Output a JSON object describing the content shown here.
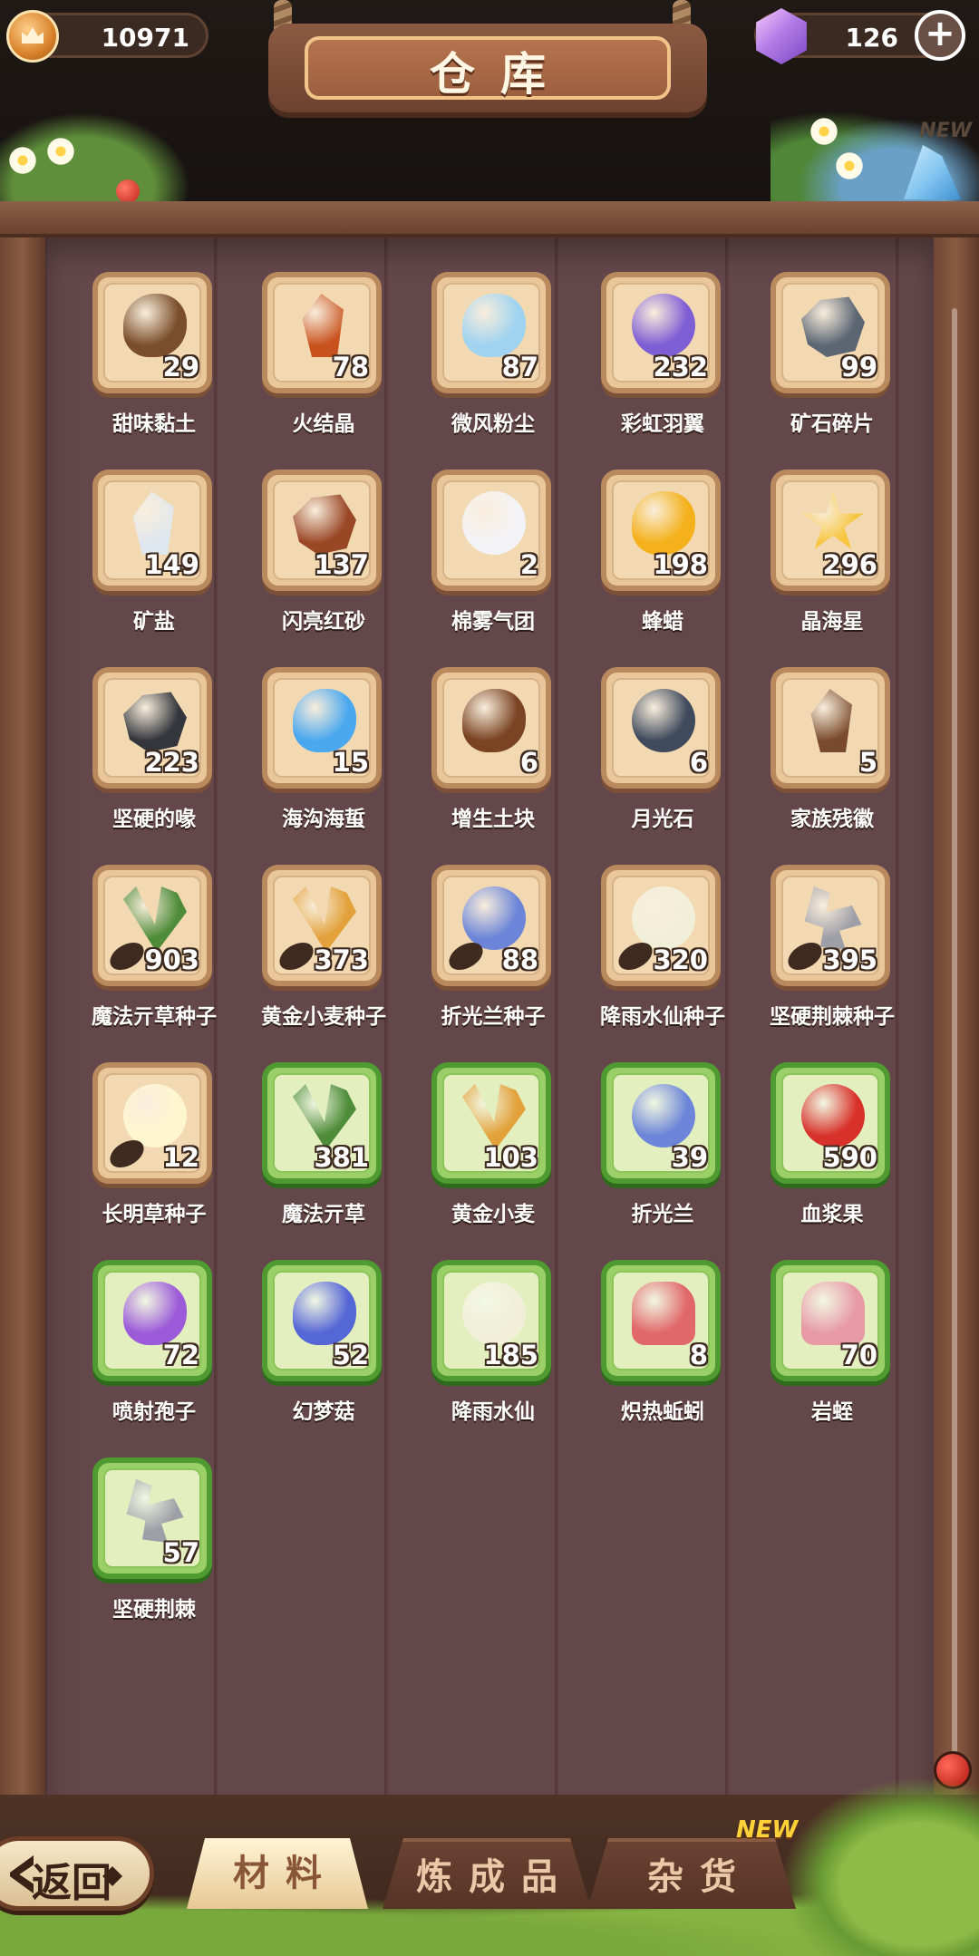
{
  "header": {
    "title": "仓库",
    "coins": "10971",
    "gems": "126"
  },
  "tabs": {
    "materials": "材料",
    "products": "炼成品",
    "goods": "杂货",
    "goods_badge": "NEW"
  },
  "back_label": "返回",
  "ghost_badge": "NEW",
  "items": [
    {
      "name": "甜味黏土",
      "qty": "29",
      "frame": "material",
      "icon": "clay-icon",
      "color": "#7a4e2a",
      "shape": "s-blob"
    },
    {
      "name": "火结晶",
      "qty": "78",
      "frame": "material",
      "icon": "fire-crystal-icon",
      "color": "#c8521e",
      "shape": "s-crystal"
    },
    {
      "name": "微风粉尘",
      "qty": "87",
      "frame": "material",
      "icon": "breeze-dust-icon",
      "color": "#9fd3f0",
      "shape": "s-blob"
    },
    {
      "name": "彩虹羽翼",
      "qty": "232",
      "frame": "material",
      "icon": "rainbow-feather-icon",
      "color": "#7e5ed4",
      "shape": "s-moon"
    },
    {
      "name": "矿石碎片",
      "qty": "99",
      "frame": "material",
      "icon": "ore-fragment-icon",
      "color": "#5c6673",
      "shape": "s-rock"
    },
    {
      "name": "矿盐",
      "qty": "149",
      "frame": "material",
      "icon": "rock-salt-icon",
      "color": "#dfe7ee",
      "shape": "s-crystal"
    },
    {
      "name": "闪亮红砂",
      "qty": "137",
      "frame": "material",
      "icon": "red-sand-icon",
      "color": "#9a4726",
      "shape": "s-rock"
    },
    {
      "name": "棉雾气团",
      "qty": "2",
      "frame": "material",
      "icon": "cotton-mist-icon",
      "color": "#f3f3f6",
      "shape": "s-circle"
    },
    {
      "name": "蜂蜡",
      "qty": "198",
      "frame": "material",
      "icon": "beeswax-icon",
      "color": "#f4b11b",
      "shape": "s-blob"
    },
    {
      "name": "晶海星",
      "qty": "296",
      "frame": "material",
      "icon": "crystal-starfish-icon",
      "color": "#f6c640",
      "shape": "s-star"
    },
    {
      "name": "坚硬的喙",
      "qty": "223",
      "frame": "material",
      "icon": "hard-beak-icon",
      "color": "#33363c",
      "shape": "s-rock"
    },
    {
      "name": "海沟海蜇",
      "qty": "15",
      "frame": "material",
      "icon": "jellyfish-icon",
      "color": "#4aa8ef",
      "shape": "s-blob"
    },
    {
      "name": "增生土块",
      "qty": "6",
      "frame": "material",
      "icon": "soil-lump-icon",
      "color": "#7a4322",
      "shape": "s-blob"
    },
    {
      "name": "月光石",
      "qty": "6",
      "frame": "material",
      "icon": "moonstone-icon",
      "color": "#3f4a5c",
      "shape": "s-moon"
    },
    {
      "name": "家族残徽",
      "qty": "5",
      "frame": "material",
      "icon": "family-crest-icon",
      "color": "#7a4a2c",
      "shape": "s-crystal"
    },
    {
      "name": "魔法亓草种子",
      "qty": "903",
      "frame": "material",
      "icon": "magic-herb-seed-icon",
      "color": "#4f8c3a",
      "shape": "s-leaf",
      "seed": true
    },
    {
      "name": "黄金小麦种子",
      "qty": "373",
      "frame": "material",
      "icon": "golden-wheat-seed-icon",
      "color": "#e2a13a",
      "shape": "s-leaf",
      "seed": true
    },
    {
      "name": "折光兰种子",
      "qty": "88",
      "frame": "material",
      "icon": "prism-orchid-seed-icon",
      "color": "#6c85d8",
      "shape": "s-flower",
      "seed": true
    },
    {
      "name": "降雨水仙种子",
      "qty": "320",
      "frame": "material",
      "icon": "rain-narcissus-seed-icon",
      "color": "#f1efd8",
      "shape": "s-flower",
      "seed": true
    },
    {
      "name": "坚硬荆棘种子",
      "qty": "395",
      "frame": "material",
      "icon": "hard-thorn-seed-icon",
      "color": "#9e9ea6",
      "shape": "s-thorn",
      "seed": true
    },
    {
      "name": "长明草种子",
      "qty": "12",
      "frame": "material",
      "icon": "everbright-grass-seed-icon",
      "color": "#fff6d0",
      "shape": "s-flower",
      "seed": true
    },
    {
      "name": "魔法亓草",
      "qty": "381",
      "frame": "produce",
      "icon": "magic-herb-icon",
      "color": "#4f8c3a",
      "shape": "s-leaf"
    },
    {
      "name": "黄金小麦",
      "qty": "103",
      "frame": "produce",
      "icon": "golden-wheat-icon",
      "color": "#e2a13a",
      "shape": "s-leaf"
    },
    {
      "name": "折光兰",
      "qty": "39",
      "frame": "produce",
      "icon": "prism-orchid-icon",
      "color": "#6c85d8",
      "shape": "s-flower"
    },
    {
      "name": "血浆果",
      "qty": "590",
      "frame": "produce",
      "icon": "blood-berry-icon",
      "color": "#d8312a",
      "shape": "s-circle"
    },
    {
      "name": "喷射孢子",
      "qty": "72",
      "frame": "produce",
      "icon": "jet-spore-icon",
      "color": "#9b5ad8",
      "shape": "s-blob"
    },
    {
      "name": "幻梦菇",
      "qty": "52",
      "frame": "produce",
      "icon": "dream-mushroom-icon",
      "color": "#5566d6",
      "shape": "s-blob"
    },
    {
      "name": "降雨水仙",
      "qty": "185",
      "frame": "produce",
      "icon": "rain-narcissus-icon",
      "color": "#f1efd8",
      "shape": "s-flower"
    },
    {
      "name": "炽热蚯蚓",
      "qty": "8",
      "frame": "produce",
      "icon": "blazing-earthworm-icon",
      "color": "#e0676a",
      "shape": "s-worm"
    },
    {
      "name": "岩蛭",
      "qty": "70",
      "frame": "produce",
      "icon": "rock-leech-icon",
      "color": "#e79aa6",
      "shape": "s-worm"
    },
    {
      "name": "坚硬荆棘",
      "qty": "57",
      "frame": "produce",
      "icon": "hard-thorn-icon",
      "color": "#9e9ea6",
      "shape": "s-thorn"
    }
  ]
}
